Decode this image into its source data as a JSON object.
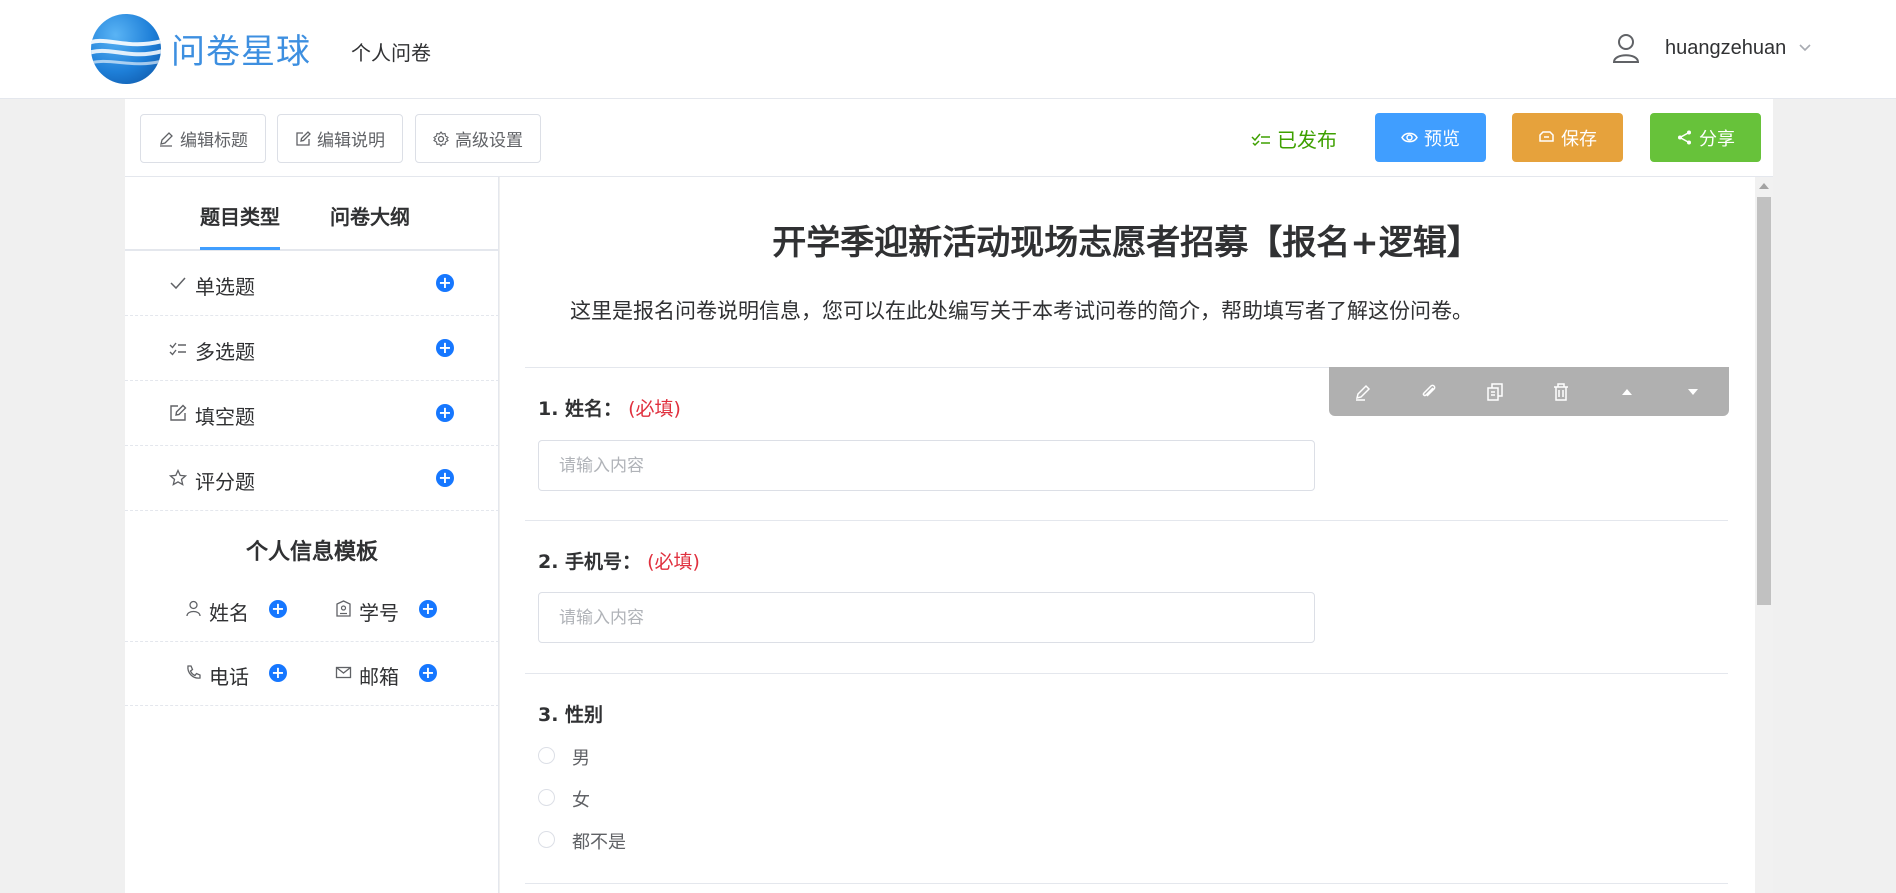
{
  "header": {
    "logo_text": "问卷星球",
    "nav_item": "个人问卷",
    "username": "huangzehuan",
    "icons": {
      "logo": "globe-logo",
      "user": "user-icon",
      "dropdown": "chevron-down-icon"
    }
  },
  "toolbar": {
    "edit_title": "编辑标题",
    "edit_desc": "编辑说明",
    "advanced": "高级设置",
    "status": "已发布",
    "preview": "预览",
    "save": "保存",
    "share": "分享",
    "colors": {
      "preview": "#409eff",
      "save": "#e6a23c",
      "share": "#67c23a",
      "status": "#3ea000"
    }
  },
  "sidebar": {
    "tabs": [
      "题目类型",
      "问卷大纲"
    ],
    "question_types": [
      {
        "label": "单选题",
        "icon": "check-icon"
      },
      {
        "label": "多选题",
        "icon": "multi-check-icon"
      },
      {
        "label": "填空题",
        "icon": "edit-square-icon"
      },
      {
        "label": "评分题",
        "icon": "star-icon"
      }
    ],
    "template_title": "个人信息模板",
    "templates": [
      {
        "label": "姓名",
        "icon": "person-icon"
      },
      {
        "label": "学号",
        "icon": "badge-icon"
      },
      {
        "label": "电话",
        "icon": "phone-icon"
      },
      {
        "label": "邮箱",
        "icon": "mail-icon"
      }
    ]
  },
  "survey": {
    "title": "开学季迎新活动现场志愿者招募【报名+逻辑】",
    "description": "这里是报名问卷说明信息，您可以在此处编写关于本考试问卷的简介，帮助填写者了解这份问卷。",
    "questions": [
      {
        "title": "1. 姓名：",
        "required": "(必填)",
        "placeholder": "请输入内容"
      },
      {
        "title": "2. 手机号：",
        "required": "(必填)",
        "placeholder": "请输入内容"
      },
      {
        "title": "3. 性别",
        "options": [
          "男",
          "女",
          "都不是"
        ]
      }
    ],
    "question_tools": [
      "edit-icon",
      "attach-icon",
      "copy-icon",
      "delete-icon",
      "move-up-icon",
      "move-down-icon"
    ]
  }
}
